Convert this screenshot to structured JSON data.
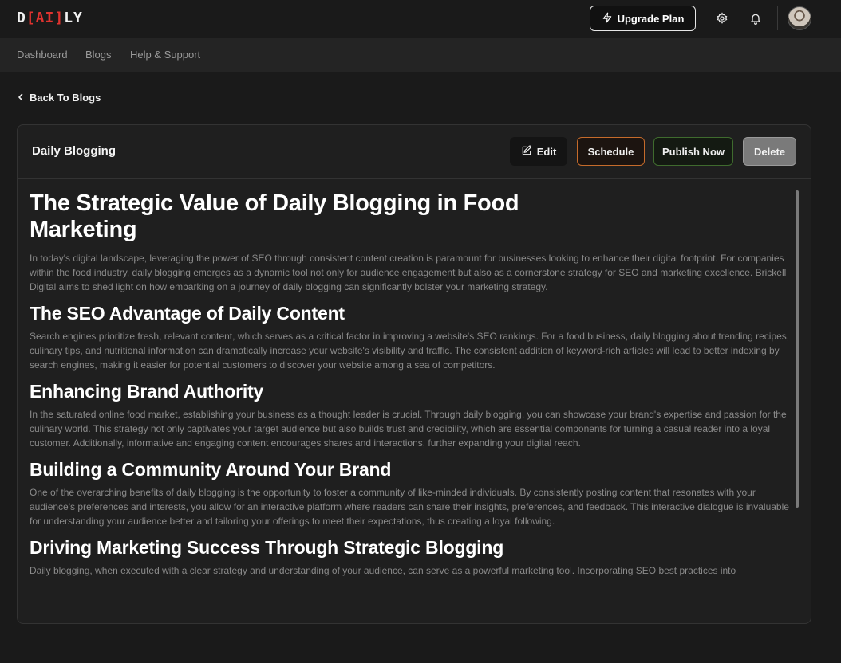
{
  "logo": {
    "prefix": "D",
    "middle": "[AI]",
    "suffix": "LY"
  },
  "header": {
    "upgrade_label": "Upgrade Plan"
  },
  "nav": {
    "items": [
      "Dashboard",
      "Blogs",
      "Help & Support"
    ]
  },
  "back_label": "Back To Blogs",
  "card": {
    "title": "Daily Blogging",
    "actions": {
      "edit": "Edit",
      "schedule": "Schedule",
      "publish": "Publish Now",
      "delete": "Delete"
    }
  },
  "article": {
    "title": "The Strategic Value of Daily Blogging in Food Marketing",
    "intro": "In today's digital landscape, leveraging the power of SEO through consistent content creation is paramount for businesses looking to enhance their digital footprint. For companies within the food industry, daily blogging emerges as a dynamic tool not only for audience engagement but also as a cornerstone strategy for SEO and marketing excellence. Brickell Digital aims to shed light on how embarking on a journey of daily blogging can significantly bolster your marketing strategy.",
    "sections": [
      {
        "heading": "The SEO Advantage of Daily Content",
        "body": "Search engines prioritize fresh, relevant content, which serves as a critical factor in improving a website's SEO rankings. For a food business, daily blogging about trending recipes, culinary tips, and nutritional information can dramatically increase your website's visibility and traffic. The consistent addition of keyword-rich articles will lead to better indexing by search engines, making it easier for potential customers to discover your website among a sea of competitors."
      },
      {
        "heading": "Enhancing Brand Authority",
        "body": "In the saturated online food market, establishing your business as a thought leader is crucial. Through daily blogging, you can showcase your brand's expertise and passion for the culinary world. This strategy not only captivates your target audience but also builds trust and credibility, which are essential components for turning a casual reader into a loyal customer. Additionally, informative and engaging content encourages shares and interactions, further expanding your digital reach."
      },
      {
        "heading": "Building a Community Around Your Brand",
        "body": "One of the overarching benefits of daily blogging is the opportunity to foster a community of like-minded individuals. By consistently posting content that resonates with your audience's preferences and interests, you allow for an interactive platform where readers can share their insights, preferences, and feedback. This interactive dialogue is invaluable for understanding your audience better and tailoring your offerings to meet their expectations, thus creating a loyal following."
      },
      {
        "heading": "Driving Marketing Success Through Strategic Blogging",
        "body": "Daily blogging, when executed with a clear strategy and understanding of your audience, can serve as a powerful marketing tool. Incorporating SEO best practices into"
      }
    ]
  },
  "colors": {
    "accent_ai": "#e0332f",
    "schedule_border": "#c56b2b",
    "publish_border": "#3f6b2e",
    "delete_bg": "#7a7a7a"
  },
  "icons": [
    "lightning-icon",
    "gear-icon",
    "bell-icon",
    "chevron-left-icon",
    "edit-icon"
  ]
}
